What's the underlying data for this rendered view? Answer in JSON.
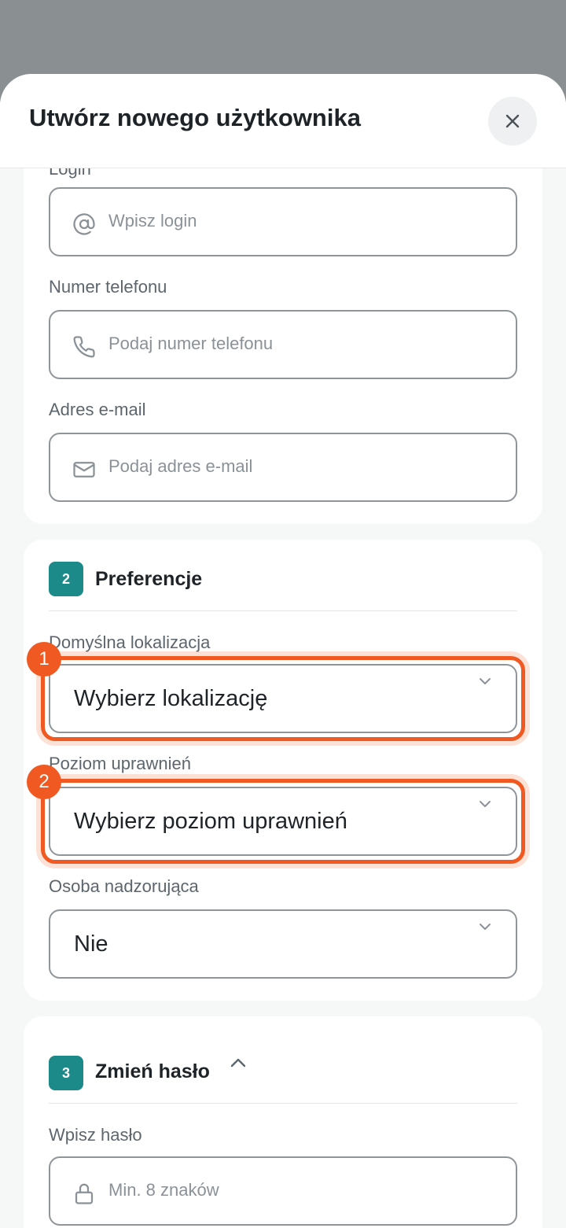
{
  "title": "Utwórz nowego użytkownika",
  "section1": {
    "fields": [
      {
        "label": "Login",
        "placeholder": "Wpisz login",
        "icon": "at-icon"
      },
      {
        "label": "Numer telefonu",
        "placeholder": "Podaj numer telefonu",
        "icon": "phone-icon"
      },
      {
        "label": "Adres e-mail",
        "placeholder": "Podaj adres e-mail",
        "icon": "mail-icon"
      }
    ]
  },
  "section2": {
    "number": "2",
    "title": "Preferencje",
    "fields": [
      {
        "label": "Domyślna lokalizacja",
        "value": "Wybierz lokalizację",
        "marker": "1"
      },
      {
        "label": "Poziom uprawnień",
        "value": "Wybierz poziom uprawnień",
        "marker": "2"
      },
      {
        "label": "Osoba nadzorująca",
        "value": "Nie"
      }
    ]
  },
  "section3": {
    "number": "3",
    "title": "Zmień hasło",
    "fields": [
      {
        "label": "Wpisz hasło",
        "placeholder": "Min. 8 znaków",
        "icon": "lock-icon"
      }
    ]
  },
  "colors": {
    "accent": "#1b8a88",
    "highlight": "#f05a22"
  }
}
